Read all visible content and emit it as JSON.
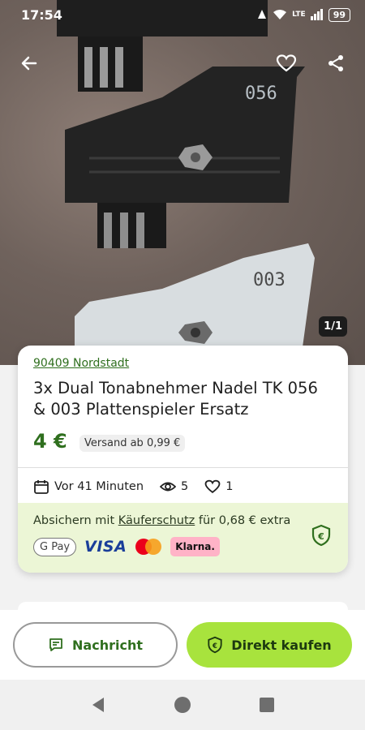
{
  "status_bar": {
    "time": "17:54",
    "network": "LTE",
    "battery": "99"
  },
  "gallery": {
    "counter": "1/1",
    "labels": [
      "056",
      "003"
    ]
  },
  "listing": {
    "location": "90409 Nordstadt",
    "title": "3x Dual Tonabnehmer Nadel TK 056 & 003 Plattenspieler Ersatz",
    "price": "4 €",
    "shipping": "Versand ab 0,99 €",
    "posted": "Vor 41 Minuten",
    "views": "5",
    "likes": "1"
  },
  "protection": {
    "prefix": "Absichern mit ",
    "link": "Käuferschutz",
    "suffix": " für 0,68 € extra",
    "payments": {
      "gpay": "G Pay",
      "visa": "VISA",
      "klarna": "Klarna."
    }
  },
  "actions": {
    "message": "Nachricht",
    "buy": "Direkt kaufen"
  },
  "colors": {
    "brand_green": "#2f6f1e",
    "buy_button": "#a8e33d",
    "protect_bg": "#ecf6d6"
  }
}
